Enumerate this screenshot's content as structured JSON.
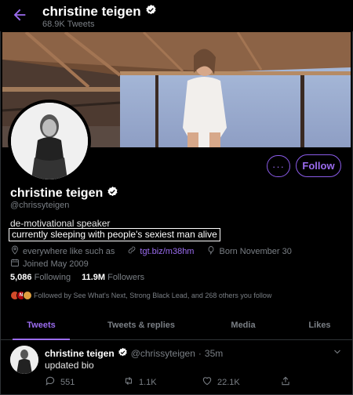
{
  "colors": {
    "accent": "#9b6cf0",
    "background": "#000000",
    "verified": "#ffffff"
  },
  "header": {
    "back_icon": "arrow-left-icon",
    "name": "christine teigen",
    "tweet_count": "68.9K Tweets"
  },
  "banner": {
    "alt": ""
  },
  "actions": {
    "more_label": "···",
    "follow_label": "Follow"
  },
  "profile": {
    "name": "christine teigen",
    "handle": "@chrissyteigen",
    "bio_line1": "de-motivational speaker",
    "bio_line2": "currently sleeping with people's sexiest man alive",
    "location": "everywhere like such as",
    "link": "tgt.biz/m38hm",
    "born": "Born November 30",
    "joined": "Joined May 2009"
  },
  "stats": {
    "following_count": "5,086",
    "following_label": "Following",
    "followers_count": "11.9M",
    "followers_label": "Followers"
  },
  "followed_by": {
    "avatar_labels": [
      "",
      "N",
      ""
    ],
    "text": "Followed by See What's Next, Strong Black Lead, and 268 others you follow"
  },
  "tabs": [
    {
      "label": "Tweets",
      "active": true
    },
    {
      "label": "Tweets & replies",
      "active": false
    },
    {
      "label": "Media",
      "active": false
    },
    {
      "label": "Likes",
      "active": false
    }
  ],
  "tweet": {
    "name": "christine teigen",
    "handle": "@chrissyteigen",
    "separator": "·",
    "time": "35m",
    "text": "updated bio",
    "replies": "551",
    "retweets": "1.1K",
    "likes": "22.1K"
  }
}
